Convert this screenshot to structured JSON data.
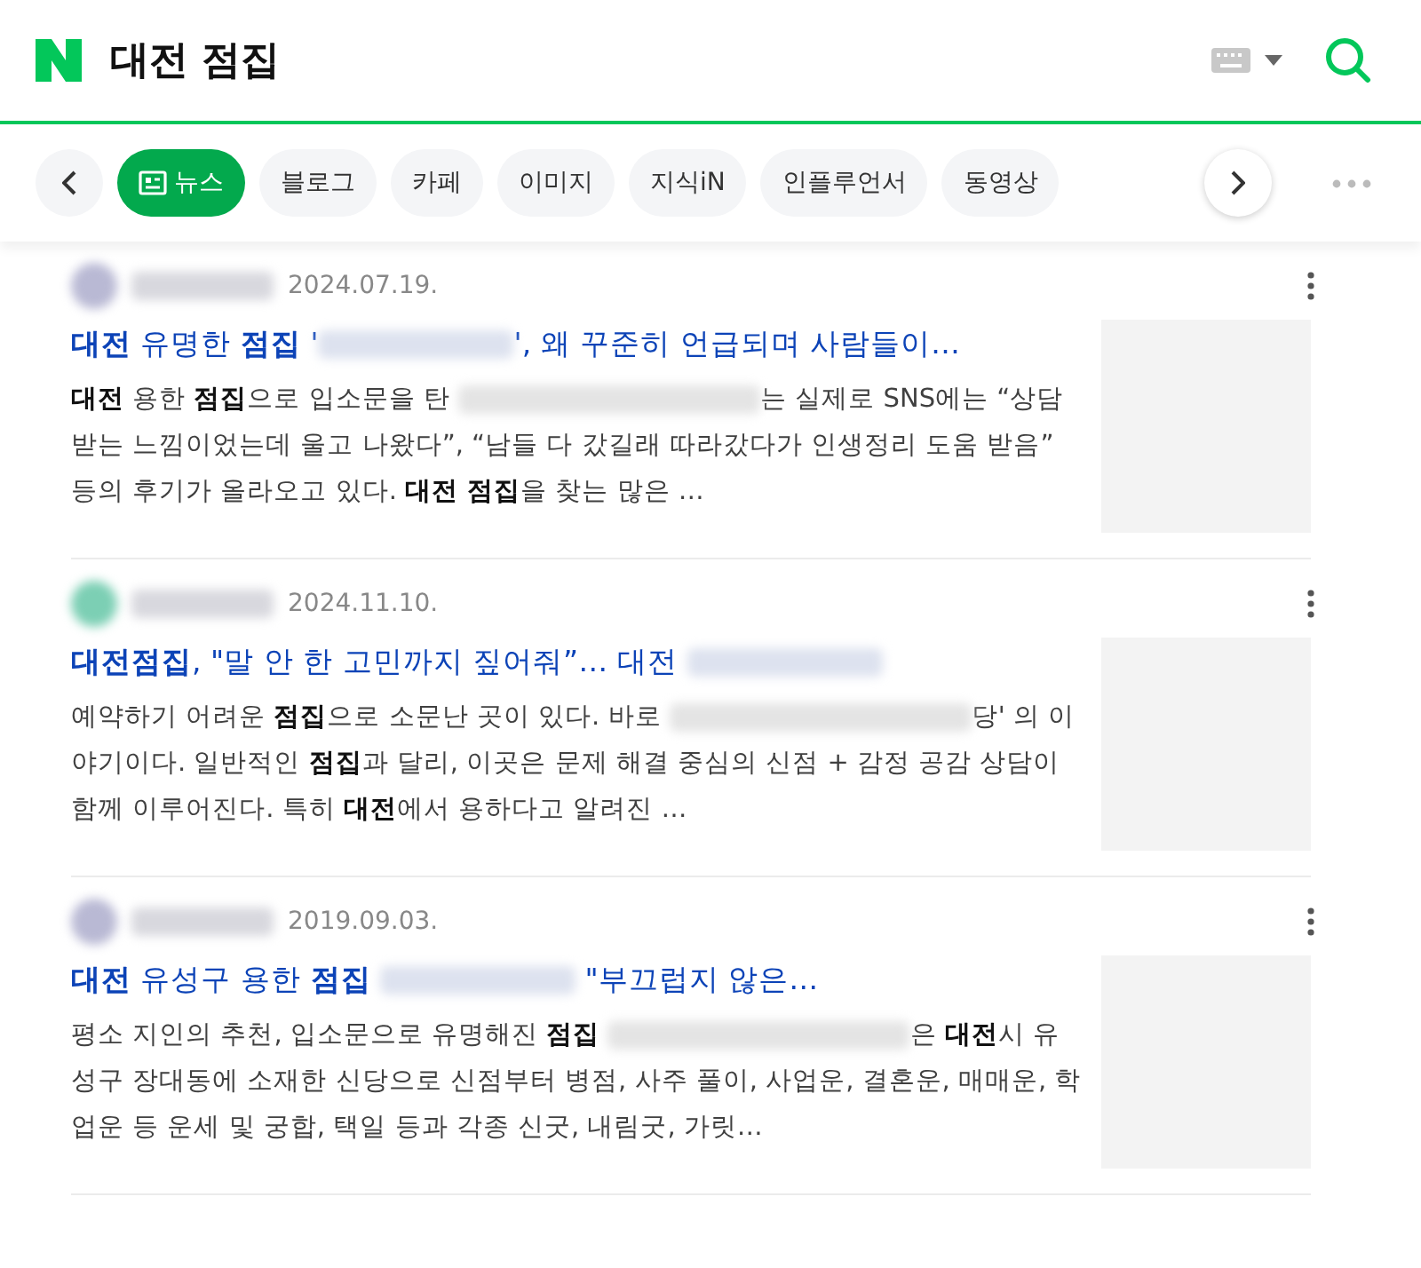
{
  "header": {
    "query": "대전 점집"
  },
  "tabs": [
    {
      "label": "뉴스",
      "selected": true,
      "kind": "news"
    },
    {
      "label": "블로그",
      "selected": false
    },
    {
      "label": "카페",
      "selected": false
    },
    {
      "label": "이미지",
      "selected": false
    },
    {
      "label": "지식iN",
      "selected": false
    },
    {
      "label": "인플루언서",
      "selected": false
    },
    {
      "label": "동영상",
      "selected": false
    }
  ],
  "results": [
    {
      "color": "#b9b9d4",
      "date": "2024.07.19.",
      "title": [
        {
          "kind": "text",
          "text": "**대전** 유명한 **점집** '"
        },
        {
          "kind": "redacted"
        },
        {
          "kind": "text",
          "text": "', 왜 꾸준히 언급되며 사람들이…"
        }
      ],
      "description": [
        {
          "kind": "text",
          "text": "**대전** 용한 **점집**으로 입소문을 탄 "
        },
        {
          "kind": "redacted"
        },
        {
          "kind": "text",
          "text": "는 실제로 SNS에는 “상담받는 느낌이었는데 울고 나왔다”, “남들 다 갔길래 따라갔다가 인생정리 도움 받음” 등의 후기가 올라오고 있다. **대전 점집**을 찾는 많은 …"
        }
      ]
    },
    {
      "color": "#7ccfb4",
      "date": "2024.11.10.",
      "title": [
        {
          "kind": "text",
          "text": "**대전점집**, \"말 안 한 고민까지 짚어줘”… 대전 "
        },
        {
          "kind": "redacted"
        }
      ],
      "description": [
        {
          "kind": "text",
          "text": "예약하기 어려운 **점집**으로 소문난 곳이 있다. 바로 "
        },
        {
          "kind": "redacted"
        },
        {
          "kind": "text",
          "text": "당' 의 이야기이다. 일반적인 **점집**과 달리, 이곳은 문제 해결 중심의 신점 + 감정 공감 상담이 함께 이루어진다. 특히 **대전**에서 용하다고 알려진 …"
        }
      ]
    },
    {
      "color": "#b9b9d4",
      "date": "2019.09.03.",
      "title": [
        {
          "kind": "text",
          "text": "**대전** 유성구 용한 **점집** "
        },
        {
          "kind": "redacted"
        },
        {
          "kind": "text",
          "text": " \"부끄럽지 않은…"
        }
      ],
      "description": [
        {
          "kind": "text",
          "text": "평소 지인의 추천, 입소문으로 유명해진 **점집** "
        },
        {
          "kind": "redacted"
        },
        {
          "kind": "text",
          "text": "은 **대전**시 유성구 장대동에 소재한 신당으로 신점부터 병점, 사주 풀이, 사업운, 결혼운, 매매운, 학업운 등 운세 및 궁합, 택일 등과 각종 신굿, 내림굿, 가릿…"
        }
      ]
    }
  ]
}
